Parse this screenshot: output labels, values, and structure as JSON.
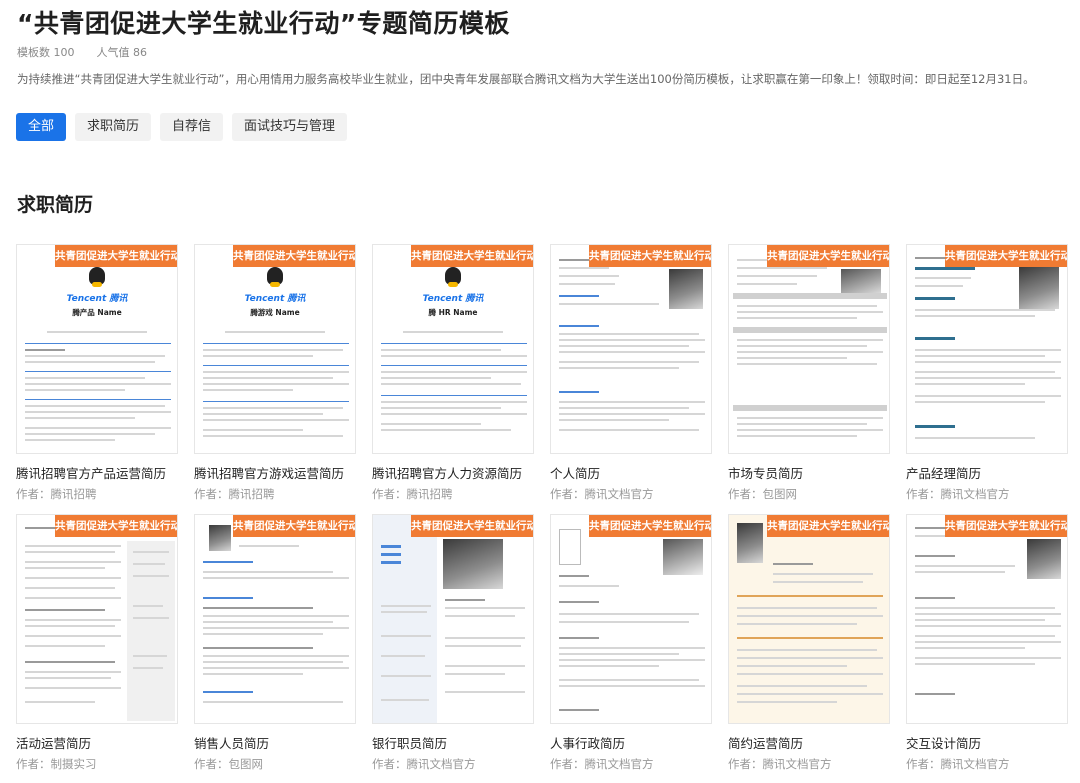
{
  "header": {
    "title": "“共青团促进大学生就业行动”专题简历模板",
    "template_count": "模板数 100",
    "popularity": "人气值 86",
    "description": "为持续推进“共青团促进大学生就业行动”，用心用情用力服务高校毕业生就业，团中央青年发展部联合腾讯文档为大学生送出100份简历模板，让求职赢在第一印象上！领取时间：即日起至12月31日。"
  },
  "tabs": [
    {
      "label": "全部",
      "active": true
    },
    {
      "label": "求职简历",
      "active": false
    },
    {
      "label": "自荐信",
      "active": false
    },
    {
      "label": "面试技巧与管理",
      "active": false
    }
  ],
  "section": {
    "title": "求职简历"
  },
  "banner_text": "共青团促进大学生就业行动",
  "thumb_text": {
    "brand": "Tencent 腾讯",
    "product": "腾产品 Name",
    "game": "腾游戏 Name",
    "hr": "腾 HR Name"
  },
  "colors": {
    "accent": "#1a73e8",
    "banner": "#f07b33"
  },
  "cards": [
    {
      "name": "腾讯招聘官方产品运营简历",
      "author": "作者：腾讯招聘"
    },
    {
      "name": "腾讯招聘官方游戏运营简历",
      "author": "作者：腾讯招聘"
    },
    {
      "name": "腾讯招聘官方人力资源简历",
      "author": "作者：腾讯招聘"
    },
    {
      "name": "个人简历",
      "author": "作者：腾讯文档官方"
    },
    {
      "name": "市场专员简历",
      "author": "作者：包图网"
    },
    {
      "name": "产品经理简历",
      "author": "作者：腾讯文档官方"
    },
    {
      "name": "活动运营简历",
      "author": "作者：制摄实习"
    },
    {
      "name": "销售人员简历",
      "author": "作者：包图网"
    },
    {
      "name": "银行职员简历",
      "author": "作者：腾讯文档官方"
    },
    {
      "name": "人事行政简历",
      "author": "作者：腾讯文档官方"
    },
    {
      "name": "简约运营简历",
      "author": "作者：腾讯文档官方"
    },
    {
      "name": "交互设计简历",
      "author": "作者：腾讯文档官方"
    }
  ]
}
